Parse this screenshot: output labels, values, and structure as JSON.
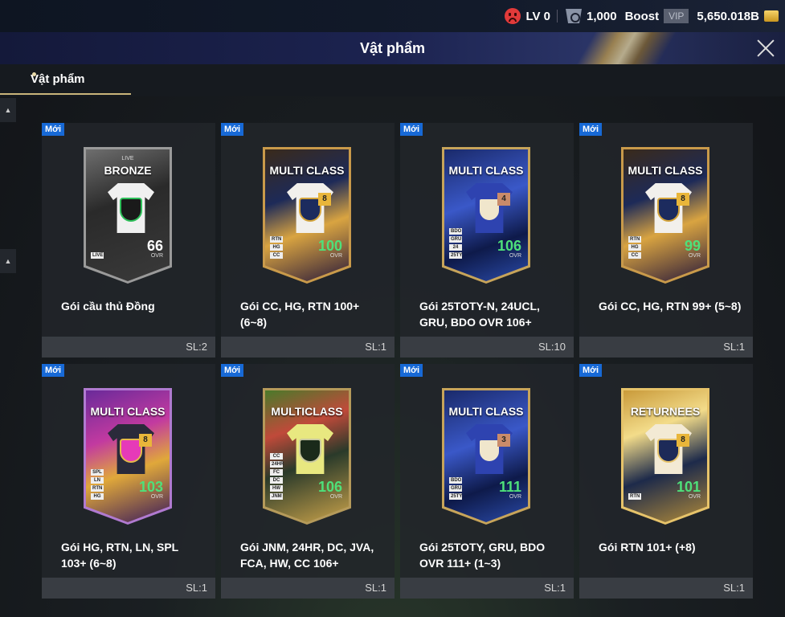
{
  "status": {
    "level": "LV 0",
    "points": "1,000",
    "boost": "Boost",
    "vip": "VIP",
    "balance": "5,650.018B"
  },
  "header": {
    "title": "Vật phẩm"
  },
  "tabs": [
    {
      "label": "Vật phẩm"
    }
  ],
  "new_badge": "Mới",
  "items": [
    {
      "name": "Gói cầu thủ Đồng",
      "qty": "SL:2",
      "pack_label": "BRONZE",
      "pack_sub": "LIVE",
      "ovr": "66",
      "level": "",
      "chips": [
        "LIVE"
      ],
      "theme": "bronze"
    },
    {
      "name": "Gói CC, HG, RTN 100+ (6~8)",
      "qty": "SL:1",
      "pack_label": "MULTI CLASS",
      "pack_sub": "",
      "ovr": "100",
      "level": "8",
      "chips": [
        "RTN",
        "HG",
        "CC"
      ],
      "theme": "multiclass-gold"
    },
    {
      "name": "Gói 25TOTY-N, 24UCL, GRU, BDO OVR 106+",
      "qty": "SL:10",
      "pack_label": "MULTI CLASS",
      "pack_sub": "",
      "ovr": "106",
      "level": "4",
      "chips": [
        "BDO",
        "GRU",
        "24",
        "25TY"
      ],
      "theme": "toty"
    },
    {
      "name": "Gói CC, HG, RTN 99+ (5~8)",
      "qty": "SL:1",
      "pack_label": "MULTI CLASS",
      "pack_sub": "",
      "ovr": "99",
      "level": "8",
      "chips": [
        "RTN",
        "HG",
        "CC"
      ],
      "theme": "multiclass-gold"
    },
    {
      "name": "Gói HG, RTN, LN, SPL 103+ (6~8)",
      "qty": "SL:1",
      "pack_label": "MULTI CLASS",
      "pack_sub": "",
      "ovr": "103",
      "level": "8",
      "chips": [
        "SPL",
        "LN",
        "RTN",
        "HG"
      ],
      "theme": "purple"
    },
    {
      "name": "Gói JNM, 24HR, DC, JVA, FCA, HW, CC 106+",
      "qty": "SL:1",
      "pack_label": "MULTICLASS",
      "pack_sub": "",
      "ovr": "106",
      "level": "",
      "chips": [
        "CC",
        "24HR",
        "FC",
        "DC",
        "HW",
        "JNM"
      ],
      "theme": "green"
    },
    {
      "name": "Gói 25TOTY, GRU, BDO OVR 111+ (1~3)",
      "qty": "SL:1",
      "pack_label": "MULTI CLASS",
      "pack_sub": "",
      "ovr": "111",
      "level": "3",
      "chips": [
        "BDO",
        "GRU",
        "25TY"
      ],
      "theme": "toty"
    },
    {
      "name": "Gói RTN 101+ (+8)",
      "qty": "SL:1",
      "pack_label": "RETURNEES",
      "pack_sub": "",
      "ovr": "101",
      "level": "8",
      "chips": [
        "RTN"
      ],
      "theme": "returnees"
    }
  ],
  "ovr_label": "OVR"
}
